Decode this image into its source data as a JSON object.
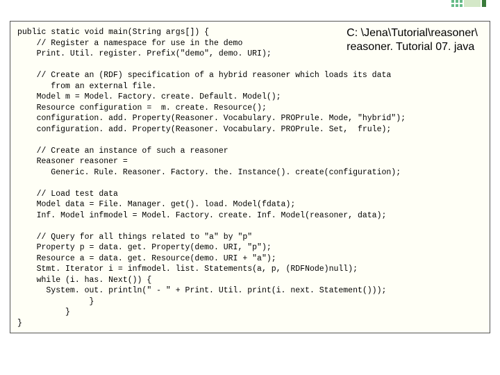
{
  "path": {
    "line1": "C: \\Jena\\Tutorial\\reasoner\\",
    "line2": "reasoner. Tutorial 07. java"
  },
  "code": "public static void main(String args[]) {\n    // Register a namespace for use in the demo\n    Print. Util. register. Prefix(\"demo\", demo. URI);\n\n    // Create an (RDF) specification of a hybrid reasoner which loads its data\n       from an external file.\n    Model m = Model. Factory. create. Default. Model();\n    Resource configuration =  m. create. Resource();\n    configuration. add. Property(Reasoner. Vocabulary. PROPrule. Mode, \"hybrid\");\n    configuration. add. Property(Reasoner. Vocabulary. PROPrule. Set,  frule);\n\n    // Create an instance of such a reasoner\n    Reasoner reasoner =\n       Generic. Rule. Reasoner. Factory. the. Instance(). create(configuration);\n\n    // Load test data\n    Model data = File. Manager. get(). load. Model(fdata);\n    Inf. Model infmodel = Model. Factory. create. Inf. Model(reasoner, data);\n\n    // Query for all things related to \"a\" by \"p\"\n    Property p = data. get. Property(demo. URI, \"p\");\n    Resource a = data. get. Resource(demo. URI + \"a\");\n    Stmt. Iterator i = infmodel. list. Statements(a, p, (RDFNode)null);\n    while (i. has. Next()) {\n      System. out. println(\" - \" + Print. Util. print(i. next. Statement()));\n               }\n          }\n}"
}
